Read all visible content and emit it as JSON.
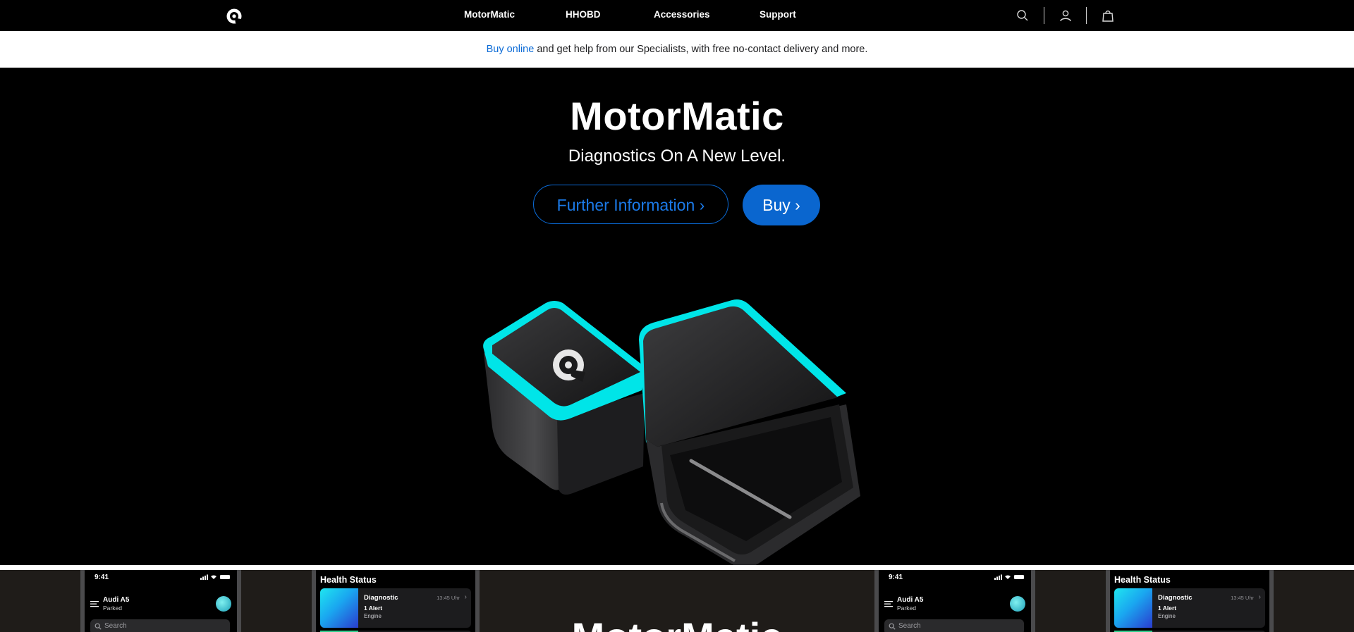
{
  "nav": {
    "logo_icon": "motormatic-logo-icon",
    "links": [
      "MotorMatic",
      "HHOBD",
      "Accessories",
      "Support"
    ],
    "icons": [
      "search-icon",
      "account-icon",
      "bag-icon"
    ]
  },
  "promo": {
    "link_text": "Buy online",
    "text": " and get help from our Specialists, with free no-contact delivery and more."
  },
  "hero": {
    "title": "MotorMatic",
    "subtitle": "Diagnostics On A New Level.",
    "further_button": "Further Information ›",
    "buy_button": "Buy ›",
    "accent_color": "#0a66cf",
    "product_glow_color": "#1ff2f2"
  },
  "strip": {
    "title": "MotorMatic",
    "phone": {
      "time": "9:41",
      "car_name": "Audi A5",
      "car_status": "Parked",
      "search_placeholder": "Search"
    },
    "health": {
      "title": "Health Status",
      "card_title": "Diagnostic",
      "card_time": "13:45 Uhr",
      "card_alert": "1 Alert",
      "card_sub": "Engine"
    }
  }
}
